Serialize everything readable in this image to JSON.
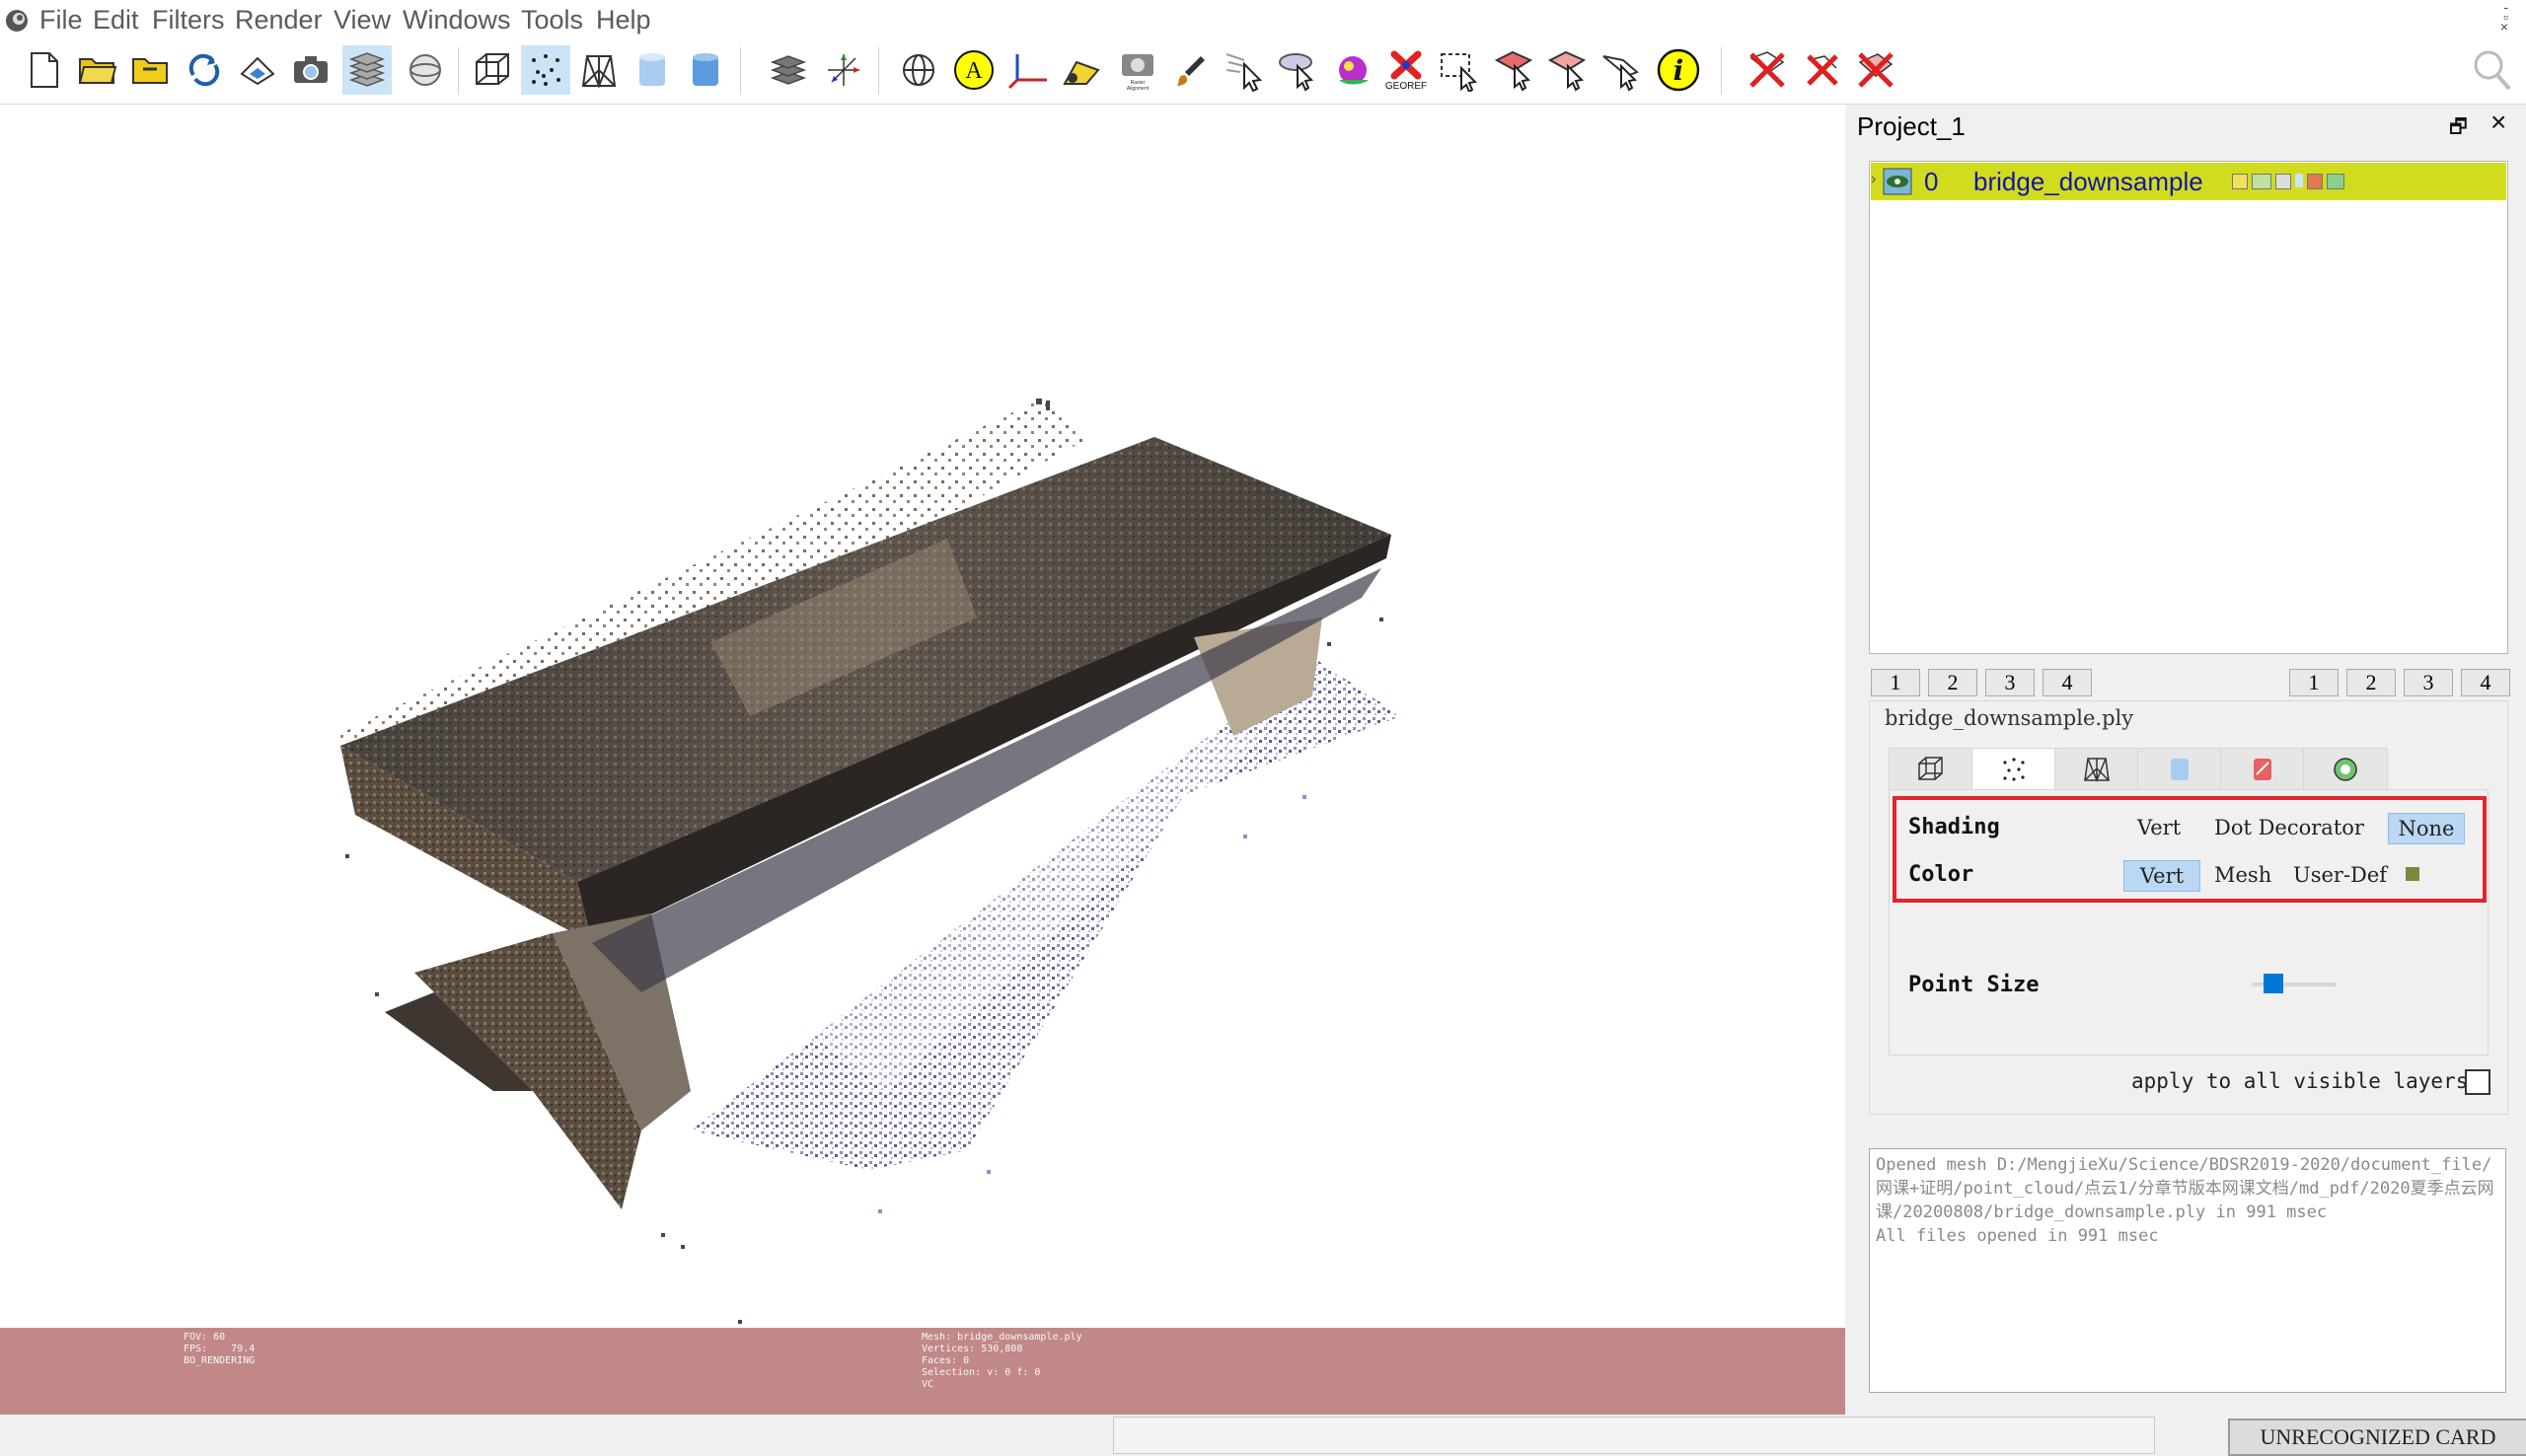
{
  "menu": [
    "File",
    "Edit",
    "Filters",
    "Render",
    "View",
    "Windows",
    "Tools",
    "Help"
  ],
  "toolbar": {
    "georef_label": "GEOREF",
    "raster_label": "Raster Alignment"
  },
  "viewport": {
    "info_left": "FOV: 60\nFPS:    79.4\nBO_RENDERING",
    "info_right": "Mesh: bridge_downsample.ply\nVertices: 530,808\nFaces: 0\nSelection: v: 0 f: 0\nVC"
  },
  "panel": {
    "title": "Project_1",
    "layer": {
      "index": "0",
      "name": "bridge_downsample"
    },
    "view_buttons_left": [
      "1",
      "2",
      "3",
      "4"
    ],
    "view_buttons_right": [
      "1",
      "2",
      "3",
      "4"
    ],
    "file_name": "bridge_downsample.ply",
    "shading": {
      "label": "Shading",
      "options": [
        "Vert",
        "Dot Decorator",
        "None"
      ],
      "selected": "None"
    },
    "color": {
      "label": "Color",
      "options": [
        "Vert",
        "Mesh",
        "User-Def"
      ],
      "selected": "Vert",
      "swatch": "#7a8a3a"
    },
    "point_size_label": "Point Size",
    "apply_label": "apply to all visible layers"
  },
  "log": {
    "lines": [
      "Opened mesh D:/MengjieXu/Science/BDSR2019-2020/document_file/网课+证明/point_cloud/点云1/分章节版本网课文档/md_pdf/2020夏季点云网课/20200808/bridge_downsample.ply in 991 msec",
      "All files opened in 991 msec"
    ]
  },
  "status": {
    "card": "UNRECOGNIZED CARD"
  },
  "colors": {
    "selected_layer": "#d2dc1e",
    "highlight_box": "#e0252d",
    "infobar": "#c28888",
    "selection": "#bad8f3"
  }
}
